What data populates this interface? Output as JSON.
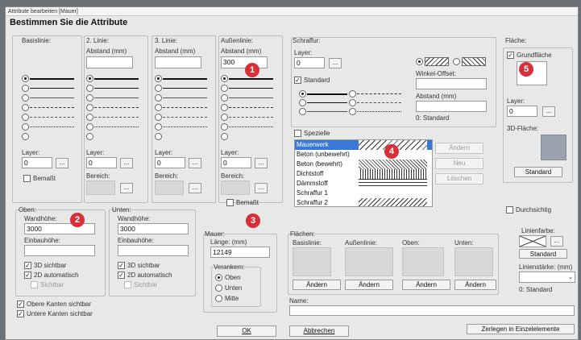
{
  "window": {
    "title": "Attribute bearbeiten [Mauer]",
    "heading": "Bestimmen Sie die Attribute"
  },
  "lines": {
    "basislinie": {
      "label": "Basislinie:"
    },
    "linie2": {
      "label": "2. Linie:",
      "abstand_label": "Abstand (mm)",
      "abstand_value": ""
    },
    "linie3": {
      "label": "3. Linie:",
      "abstand_label": "Abstand (mm)",
      "abstand_value": ""
    },
    "aussenlinie": {
      "label": "Außenlinie:",
      "abstand_label": "Abstand (mm)",
      "abstand_value": "300"
    },
    "layer_label": "Layer:",
    "layer_value": "0",
    "dots": "...",
    "bereich_label": "Bereich:",
    "bemasst_label": "Bemaßt"
  },
  "schraffur": {
    "label": "Schraffur:",
    "layer_label": "Layer:",
    "layer_value": "0",
    "standard_label": "Standard",
    "winkel_label": "Winkel-Offset:",
    "winkel_value": "",
    "abstand_label": "Abstand (mm)",
    "abstand_value": "",
    "abstand_standard": "0: Standard",
    "spezielle_label": "Spezielle",
    "list": [
      "Mauerwerk",
      "Beton (unbewehrt)",
      "Beton (bewehrt)",
      "Dichtstoff",
      "Dämmstoff",
      "Schraffur 1",
      "Schraffur 2"
    ],
    "aendern": "Ändern",
    "neu": "Neu",
    "loeschen": "Löschen"
  },
  "flaeche": {
    "label": "Fläche:",
    "grundflaeche_label": "Grundfläche",
    "layer_label": "Layer:",
    "layer_value": "0",
    "flaeche3d_label": "3D-Fläche:",
    "standard_btn": "Standard",
    "durchsichtig_label": "Durchsichtig"
  },
  "oben": {
    "label": "Oben:",
    "wandhoehe_label": "Wandhöhe:",
    "wandhoehe_value": "3000",
    "einbauhoehe_label": "Einbauhöhe:",
    "einbauhoehe_value": "",
    "sichtbar3d": "3D sichtbar",
    "automatisch2d": "2D automatisch",
    "sichtbar": "Sichtbar"
  },
  "unten": {
    "label": "Unten:",
    "wandhoehe_label": "Wandhöhe:",
    "wandhoehe_value": "3000",
    "einbauhoehe_label": "Einbauhöhe:",
    "einbauhoehe_value": "",
    "sichtbar3d": "3D sichtbar",
    "automatisch2d": "2D automatisch",
    "sichtbar": "Sichtbar"
  },
  "kanten": {
    "obere": "Obere Kanten sichtbar",
    "untere": "Untere Kanten sichtbar"
  },
  "mauer": {
    "label": "Mauer:",
    "laenge_label": "Länge: (mm)",
    "laenge_value": "12149",
    "verankern_label": "Verankern:",
    "oben": "Oben",
    "unten": "Unten",
    "mitte": "Mitte"
  },
  "flaechen": {
    "label": "Flächen:",
    "cols": [
      "Basislinie:",
      "Außenlinie:",
      "Oben:",
      "Unten:"
    ],
    "aendern": "Ändern"
  },
  "linienfarbe": {
    "label": "Linienfarbe:",
    "standard_btn": "Standard",
    "staerke_label": "Linienstärke: (mm)",
    "staerke_standard": "0: Standard"
  },
  "name": {
    "label": "Name:",
    "value": ""
  },
  "buttons": {
    "ok": "OK",
    "abbrechen": "Abbrechen",
    "zerlegen": "Zerlegen in Einzelelemente"
  },
  "badges": [
    "1",
    "2",
    "3",
    "4",
    "5"
  ],
  "colors": {
    "badge": "#d7303a",
    "selection": "#3a78d6"
  }
}
